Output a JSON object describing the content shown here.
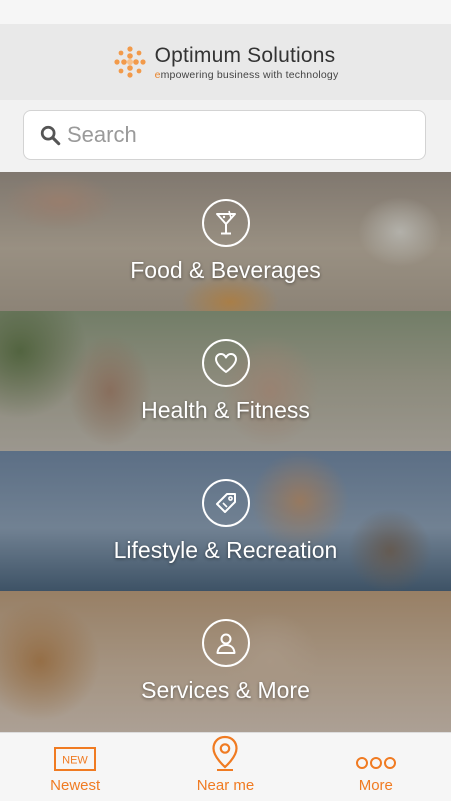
{
  "header": {
    "brand_title": "Optimum Solutions",
    "tagline_first": "e",
    "tagline_rest": "mpowering business with technology",
    "logo_icon": "orange-dot-burst-logo"
  },
  "search": {
    "placeholder": "Search",
    "value": "",
    "icon": "search-icon"
  },
  "categories": [
    {
      "label": "Food & Beverages",
      "icon": "cocktail-glass-icon"
    },
    {
      "label": "Health & Fitness",
      "icon": "heart-icon"
    },
    {
      "label": "Lifestyle & Recreation",
      "icon": "price-tag-icon"
    },
    {
      "label": "Services & More",
      "icon": "person-icon"
    }
  ],
  "tabbar": {
    "newest": {
      "label": "Newest",
      "badge": "NEW",
      "icon": "new-badge-icon"
    },
    "near_me": {
      "label": "Near me",
      "icon": "location-pin-icon"
    },
    "more": {
      "label": "More",
      "icon": "three-dots-icon"
    }
  },
  "colors": {
    "accent": "#f07b22",
    "header_bg": "#e9e9e9"
  }
}
